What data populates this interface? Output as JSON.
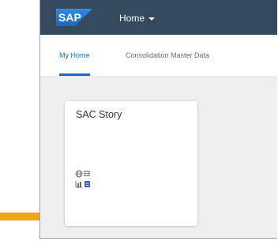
{
  "shell": {
    "logo_text": "SAP",
    "home_menu_label": "Home",
    "colors": {
      "shellbar": "#354a5f",
      "logo_blue": "#1e78d2",
      "active_tab": "#0a6ed1",
      "accent": "#f0a31f"
    }
  },
  "tabs": [
    {
      "label": "My Home",
      "active": true
    },
    {
      "label": "Consolidation Master Data",
      "active": false
    }
  ],
  "tile": {
    "title": "SAC Story",
    "icons": [
      "globe-icon",
      "chart-icon"
    ]
  }
}
